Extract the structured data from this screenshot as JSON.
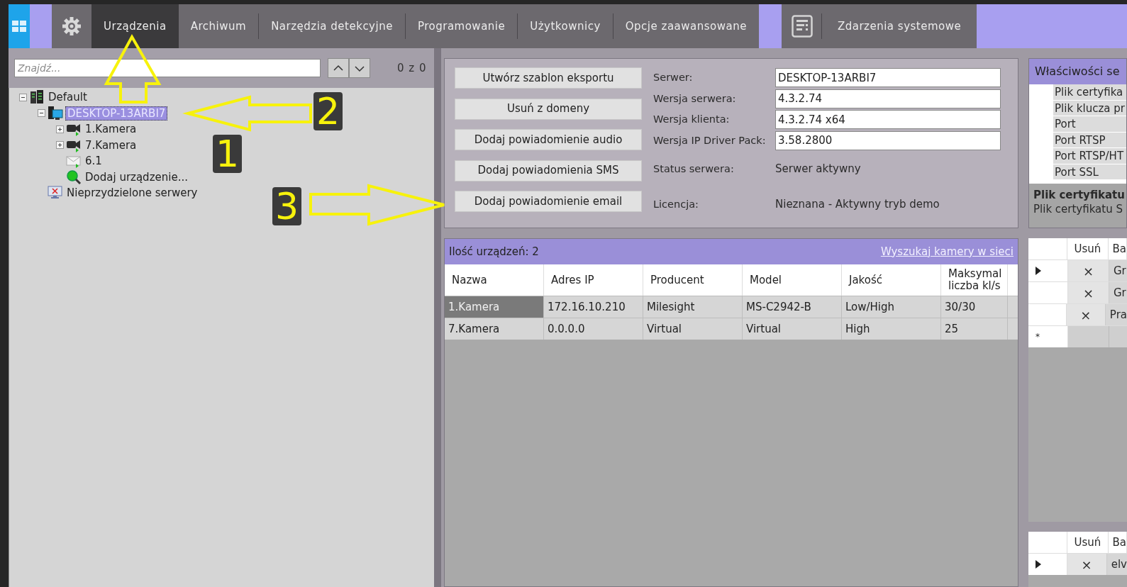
{
  "topbar": {
    "tabs": [
      {
        "label": "Urządzenia",
        "selected": true
      },
      {
        "label": "Archiwum",
        "selected": false
      },
      {
        "label": "Narzędzia detekcyjne",
        "selected": false
      },
      {
        "label": "Programowanie",
        "selected": false
      },
      {
        "label": "Użytkownicy",
        "selected": false
      },
      {
        "label": "Opcje zaawansowane",
        "selected": false
      }
    ],
    "system_tab": {
      "label": "Zdarzenia systemowe",
      "selected": false
    }
  },
  "tree_panel": {
    "search": {
      "placeholder": "Znajdź..."
    },
    "match_counter": "0 z 0",
    "tree": [
      {
        "label": "Default",
        "kind": "server-group",
        "expanded": true,
        "selected": false,
        "children": [
          {
            "label": "DESKTOP-13ARBI7",
            "kind": "server",
            "expanded": true,
            "selected": true,
            "children": [
              {
                "label": "1.Kamera",
                "kind": "camera",
                "expanded": false,
                "selected": false
              },
              {
                "label": "7.Kamera",
                "kind": "camera",
                "expanded": false,
                "selected": false
              },
              {
                "label": "6.1",
                "kind": "email",
                "selected": false
              },
              {
                "label": "Dodaj urządzenie...",
                "kind": "add",
                "selected": false
              }
            ]
          },
          {
            "label": "Nieprzydzielone serwery",
            "kind": "unassigned",
            "selected": false
          }
        ]
      }
    ]
  },
  "server_info": {
    "buttons": [
      "Utwórz szablon eksportu",
      "Usuń z domeny",
      "Dodaj powiadomienie audio",
      "Dodaj powiadomienia SMS",
      "Dodaj powiadomienie email"
    ],
    "fields": [
      {
        "label": "Serwer:",
        "kind": "input",
        "value": "DESKTOP-13ARBI7"
      },
      {
        "label": "Wersja serwera:",
        "kind": "input",
        "value": "4.3.2.74"
      },
      {
        "label": "Wersja klienta:",
        "kind": "input",
        "value": "4.3.2.74 x64"
      },
      {
        "label": "Wersja IP Driver Pack:",
        "kind": "input",
        "value": "3.58.2800"
      },
      {
        "label": "Status serwera:",
        "kind": "text",
        "value": "Serwer aktywny"
      },
      {
        "label": "Licencja:",
        "kind": "text",
        "value": "Nieznana - Aktywny tryb demo"
      }
    ]
  },
  "devices": {
    "count_label": "Ilość urządzeń: 2",
    "search_link": "Wyszukaj kamery w sieci",
    "columns": [
      "Nazwa",
      "Adres IP",
      "Producent",
      "Model",
      "Jakość",
      "Maksymal liczba kl/s"
    ],
    "rows": [
      {
        "selected": true,
        "cells": [
          "1.Kamera",
          "172.16.10.210",
          "Milesight",
          "MS-C2942-B",
          "Low/High",
          "30/30"
        ]
      },
      {
        "selected": false,
        "cells": [
          "7.Kamera",
          "0.0.0.0",
          "Virtual",
          "Virtual",
          "High",
          "25"
        ]
      }
    ]
  },
  "properties": {
    "title": "Właściwości se",
    "items": [
      "Plik certyfika",
      "Plik klucza pr",
      "Port",
      "Port RTSP",
      "Port RTSP/HT",
      "Port SSL"
    ],
    "description_title": "Plik certyfikatu",
    "description": "Plik certyfikatu S"
  },
  "side_tables": [
    {
      "columns": [
        "Usuń",
        "Ba"
      ],
      "rows": [
        {
          "current": true,
          "delete": "×",
          "cell": "Gr"
        },
        {
          "current": false,
          "delete": "×",
          "cell": "Gr"
        },
        {
          "current": false,
          "delete": "×",
          "cell": "Pra"
        }
      ],
      "new_row_marker": "*"
    },
    {
      "columns": [
        "Usuń",
        "Ba"
      ],
      "rows": [
        {
          "current": true,
          "delete": "×",
          "cell": "elv"
        }
      ]
    }
  ],
  "annotations": [
    {
      "kind": "up",
      "label": "1"
    },
    {
      "kind": "left",
      "label": "2"
    },
    {
      "kind": "right",
      "label": "3"
    }
  ]
}
